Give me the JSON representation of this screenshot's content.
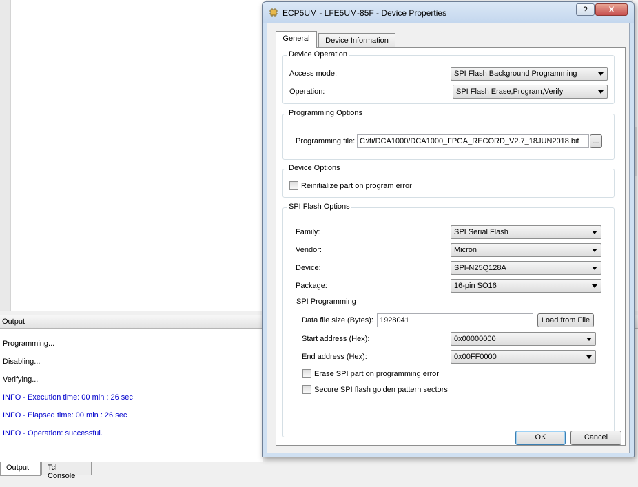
{
  "output_panel": {
    "header": "Output",
    "lines": [
      "Programming...",
      "Disabling...",
      "Verifying...",
      "INFO - Execution time: 00 min : 26 sec",
      "INFO - Elapsed time: 00 min : 26 sec",
      "INFO - Operation: successful."
    ],
    "tabs": [
      "Output",
      "Tcl Console"
    ]
  },
  "dialog": {
    "title": "ECP5UM - LFE5UM-85F - Device Properties",
    "help_label": "?",
    "close_label": "X",
    "tabs": [
      "General",
      "Device Information"
    ],
    "device_operation": {
      "title": "Device Operation",
      "access_mode_label": "Access mode:",
      "access_mode_value": "SPI Flash Background Programming",
      "operation_label": "Operation:",
      "operation_value": "SPI Flash Erase,Program,Verify"
    },
    "programming_options": {
      "title": "Programming Options",
      "file_label": "Programming file:",
      "file_value": "C:/ti/DCA1000/DCA1000_FPGA_RECORD_V2.7_18JUN2018.bit",
      "browse_label": "..."
    },
    "device_options": {
      "title": "Device Options",
      "reinit_label": "Reinitialize part on program error"
    },
    "spi_flash_options": {
      "title": "SPI Flash Options",
      "family_label": "Family:",
      "family_value": "SPI Serial Flash",
      "vendor_label": "Vendor:",
      "vendor_value": "Micron",
      "device_label": "Device:",
      "device_value": "SPI-N25Q128A",
      "package_label": "Package:",
      "package_value": "16-pin SO16",
      "spi_programming_title": "SPI Programming",
      "data_size_label": "Data file size (Bytes):",
      "data_size_value": "1928041",
      "load_button": "Load from File",
      "start_label": "Start address (Hex):",
      "start_value": "0x00000000",
      "end_label": "End address (Hex):",
      "end_value": "0x00FF0000",
      "erase_label": "Erase SPI part on programming error",
      "secure_label": "Secure SPI flash golden pattern sectors"
    },
    "ok_label": "OK",
    "cancel_label": "Cancel"
  }
}
